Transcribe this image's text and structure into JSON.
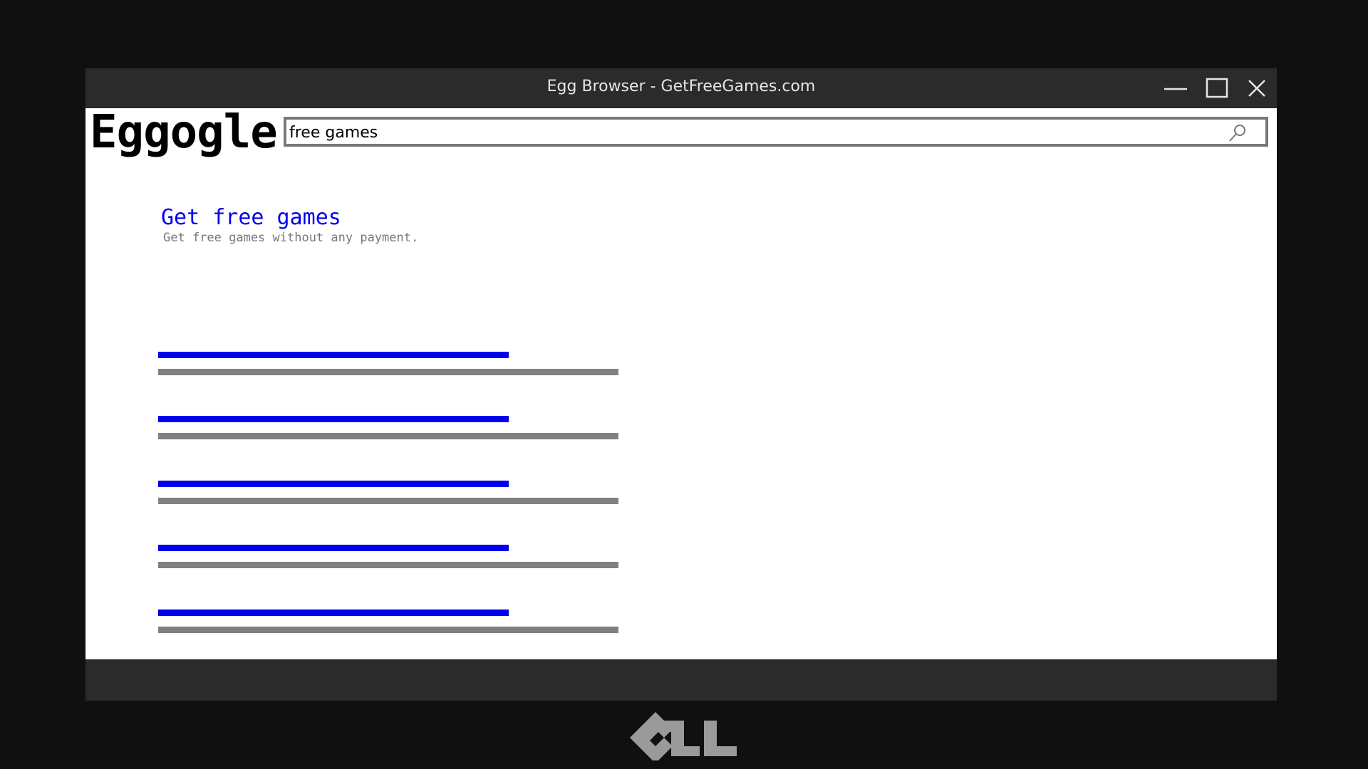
{
  "window": {
    "title": "Egg Browser - GetFreeGames.com",
    "controls": {
      "minimize_icon": "minimize-icon",
      "maximize_icon": "maximize-icon",
      "close_icon": "close-icon"
    }
  },
  "search_page": {
    "logo": "Eggogle",
    "search": {
      "value": "free games",
      "icon": "search-icon"
    },
    "results": [
      {
        "title": "Get free games",
        "description": "Get free games without any payment."
      }
    ],
    "placeholder_result_count": 5
  },
  "colors": {
    "link": "#0000ee",
    "description": "#777777",
    "chrome": "#2b2b2b",
    "background": "#101010",
    "brand_logo": "#9a9a9a"
  },
  "brand": {
    "logo_icon": "ell-logo-icon"
  }
}
